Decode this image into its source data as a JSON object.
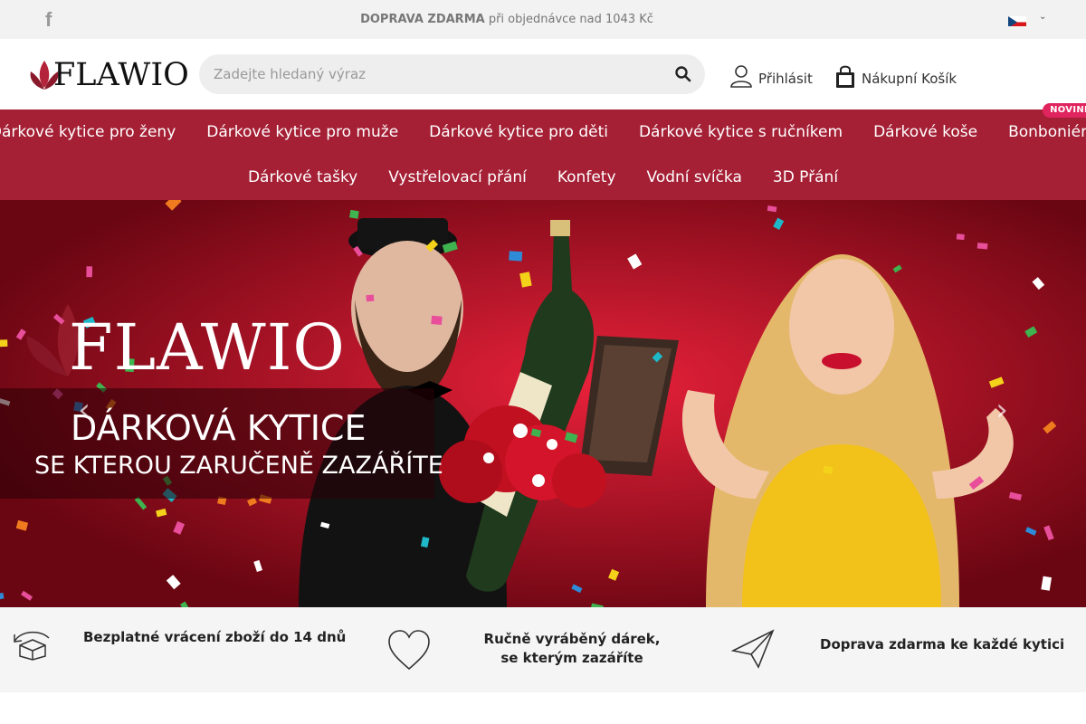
{
  "topbar": {
    "shipping_bold": "DOPRAVA ZDARMA",
    "shipping_rest": " při objednávce nad 1043 Kč",
    "facebook_icon": "facebook-icon",
    "language_icon": "czech-flag-icon"
  },
  "header": {
    "logo_text": "FLAWIO",
    "search_placeholder": "Zadejte hledaný výraz",
    "login_label": "Přihlásit",
    "cart_label": "Nákupní Košík"
  },
  "nav": {
    "row1": [
      {
        "label": "Dárkové kytice pro ženy"
      },
      {
        "label": "Dárkové kytice pro muže"
      },
      {
        "label": "Dárkové kytice pro děti"
      },
      {
        "label": "Dárkové kytice s ručníkem"
      },
      {
        "label": "Dárkové koše"
      },
      {
        "label": "Bonboniéry",
        "badge": "NOVINKA"
      }
    ],
    "row2": [
      {
        "label": "Dárkové tašky"
      },
      {
        "label": "Vystřelovací přání"
      },
      {
        "label": "Konfety"
      },
      {
        "label": "Vodní svíčka"
      },
      {
        "label": "3D Přání"
      }
    ]
  },
  "hero": {
    "brand": "FLAWIO",
    "title": "DÁRKOVÁ KYTICE",
    "subtitle": "SE KTEROU ZARUČENĚ ZAZÁŘÍTE",
    "prev_label": "‹",
    "next_label": "›"
  },
  "features": [
    {
      "icon": "box-return-icon",
      "text": "Bezplatné vrácení zboží do 14 dnů"
    },
    {
      "icon": "heart-icon",
      "line1": "Ručně vyráběný dárek,",
      "line2": "se kterým zazáříte"
    },
    {
      "icon": "paper-plane-icon",
      "text": "Doprava zdarma ke každé kytici"
    }
  ],
  "colors": {
    "nav_bg": "#a51f35",
    "badge": "#e0245e",
    "hero_red": "#c8102e"
  }
}
